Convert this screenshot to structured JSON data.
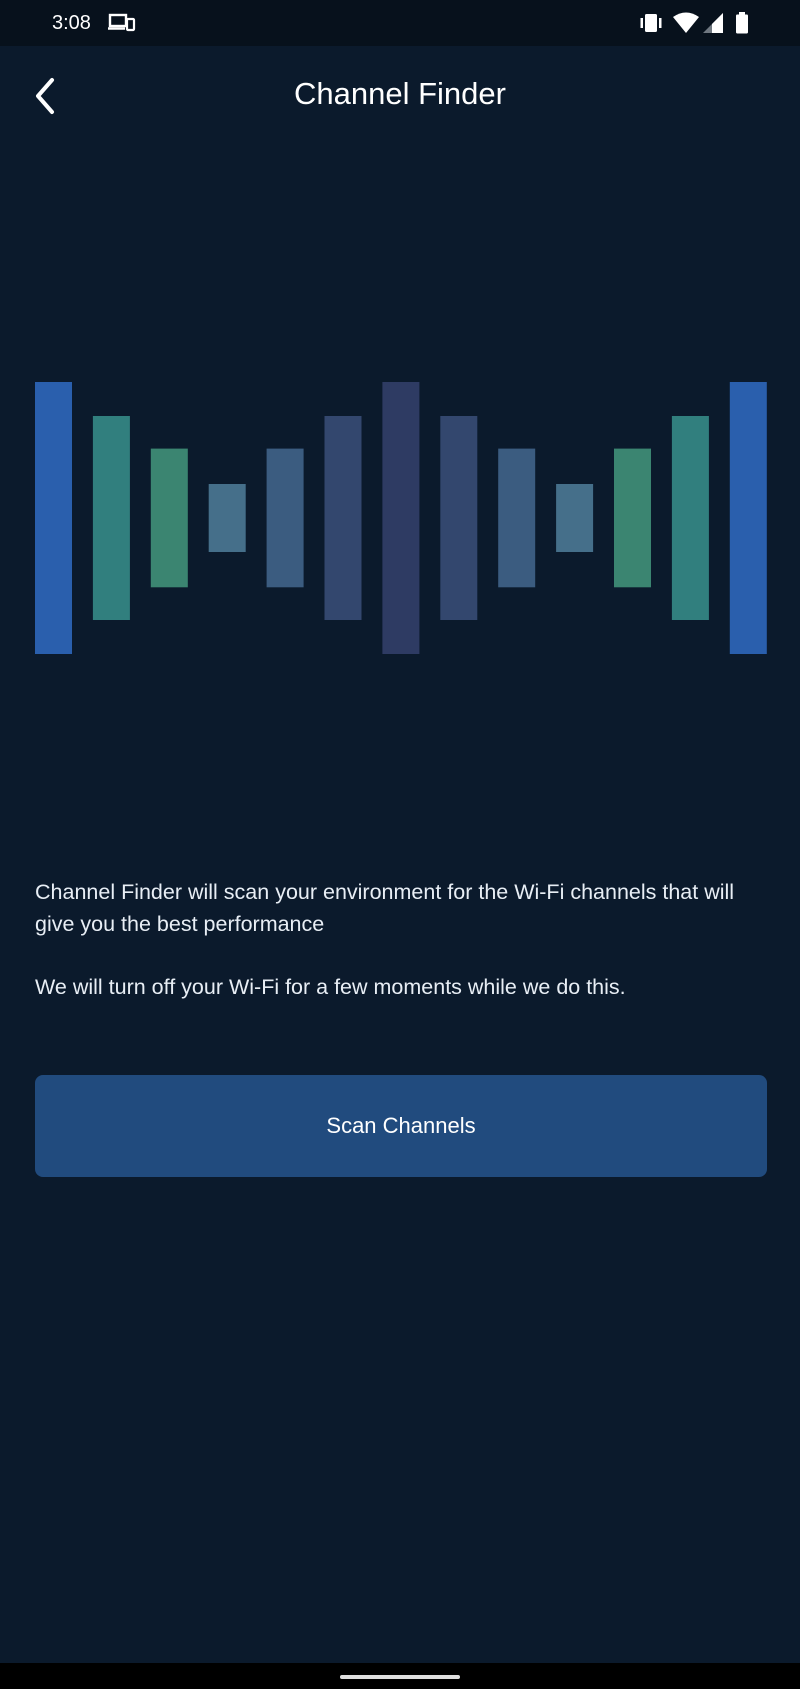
{
  "status_bar": {
    "time": "3:08",
    "icons": [
      "cast-screen-icon",
      "vibrate-icon",
      "wifi-icon",
      "cellular-signal-icon",
      "battery-icon"
    ]
  },
  "header": {
    "back_icon": "chevron-left-icon",
    "title": "Channel Finder"
  },
  "illustration": {
    "bars": [
      {
        "level": 1.0,
        "color": "#2a5fad"
      },
      {
        "level": 0.75,
        "color": "#317f7e"
      },
      {
        "level": 0.51,
        "color": "#3b8571"
      },
      {
        "level": 0.25,
        "color": "#456f8a"
      },
      {
        "level": 0.51,
        "color": "#3b5c80"
      },
      {
        "level": 0.75,
        "color": "#33476e"
      },
      {
        "level": 1.0,
        "color": "#2e3b63"
      },
      {
        "level": 0.75,
        "color": "#33476e"
      },
      {
        "level": 0.51,
        "color": "#3b5c80"
      },
      {
        "level": 0.25,
        "color": "#456f8a"
      },
      {
        "level": 0.51,
        "color": "#3b8571"
      },
      {
        "level": 0.75,
        "color": "#317f7e"
      },
      {
        "level": 1.0,
        "color": "#2a5fad"
      }
    ]
  },
  "content": {
    "description": "Channel Finder will scan your environment for the Wi-Fi channels that will give you the best performance",
    "note": "We will turn off your Wi-Fi for a few moments while we do this."
  },
  "actions": {
    "scan_label": "Scan Channels",
    "button_color": "#214b7e"
  },
  "colors": {
    "background": "#0b1a2c",
    "status_bar": "#07111c"
  }
}
